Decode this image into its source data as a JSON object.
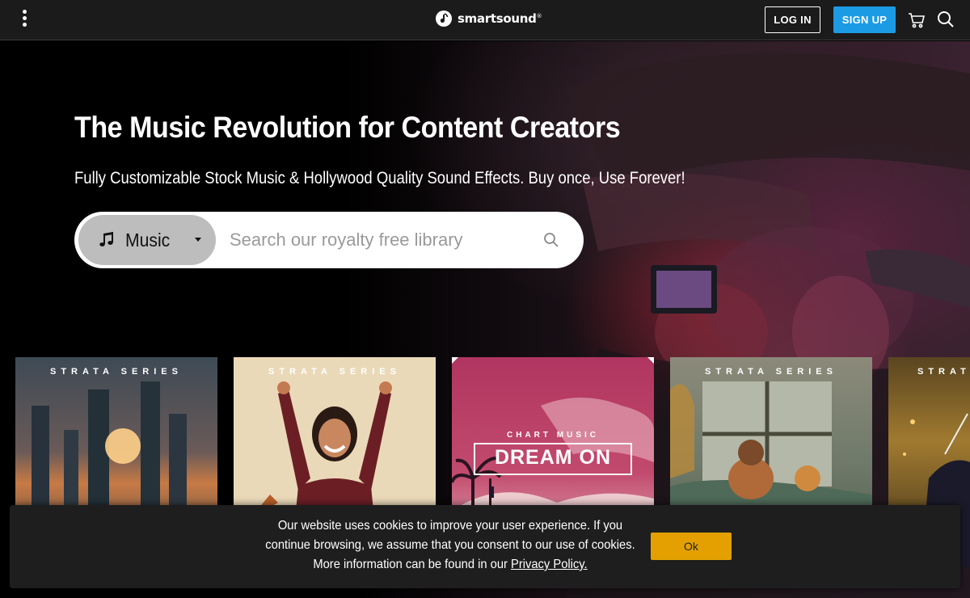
{
  "header": {
    "brand": "smartsound",
    "brand_mark": "®",
    "login_label": "LOG IN",
    "signup_label": "SIGN UP",
    "icons": [
      "kebab-menu-icon",
      "cart-icon",
      "search-icon"
    ],
    "signup_color": "#1c9be5"
  },
  "hero": {
    "title": "The Music Revolution for Content Creators",
    "subtitle": "Fully Customizable Stock Music & Hollywood Quality Sound Effects. Buy once, Use Forever!",
    "search": {
      "category": "Music",
      "placeholder": "Search our royalty free library"
    }
  },
  "albums": [
    {
      "series": "STRATA SERIES"
    },
    {
      "series": "STRATA SERIES"
    },
    {
      "label": "CHART MUSIC",
      "title": "DREAM ON"
    },
    {
      "series": "STRATA SERIES"
    },
    {
      "series": "STRAT"
    }
  ],
  "cookie": {
    "text": "Our website uses cookies to improve your user experience. If you continue browsing, we assume that you consent to our use of cookies. More information can be found in our ",
    "link": "Privacy Policy.",
    "ok_label": "Ok",
    "ok_color": "#e3a000"
  }
}
